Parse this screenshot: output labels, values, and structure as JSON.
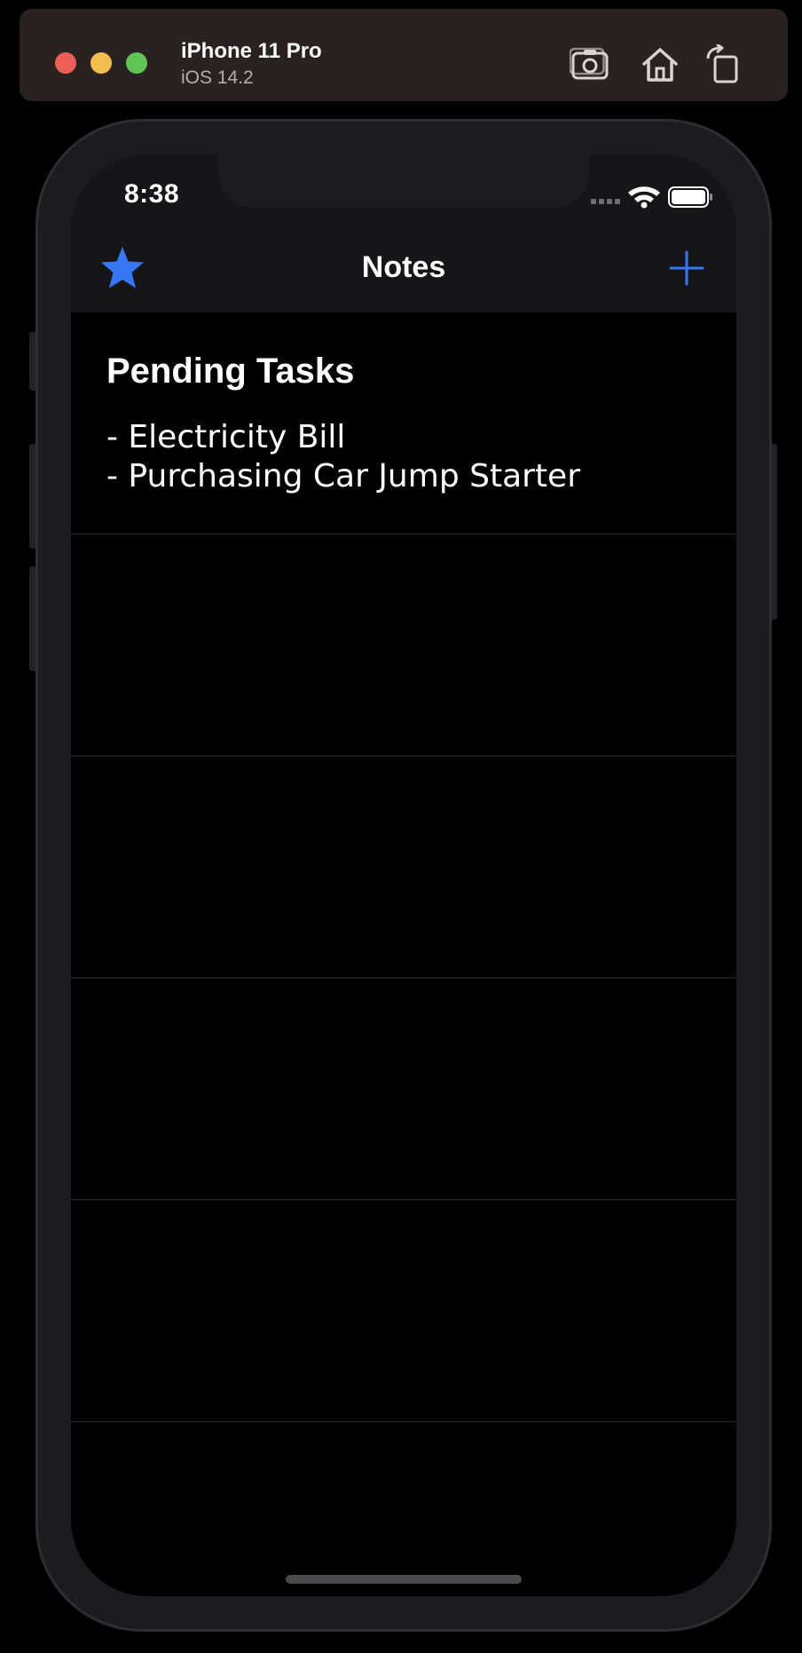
{
  "simulator": {
    "device_name": "iPhone 11 Pro",
    "os_version": "iOS 14.2",
    "toolbar_icons": [
      "camera-icon",
      "home-icon",
      "rotate-icon"
    ]
  },
  "status_bar": {
    "time": "8:38",
    "icons": [
      "signal-icon",
      "wifi-icon",
      "battery-icon"
    ]
  },
  "nav_bar": {
    "title": "Notes",
    "left_icon": "star-icon",
    "right_icon": "plus-icon",
    "accent_color": "#3478f6"
  },
  "notes": [
    {
      "title": "Pending Tasks",
      "lines": [
        "- Electricity Bill",
        "- Purchasing Car Jump Starter"
      ]
    },
    {
      "title": "",
      "lines": []
    },
    {
      "title": "",
      "lines": []
    },
    {
      "title": "",
      "lines": []
    },
    {
      "title": "",
      "lines": []
    }
  ],
  "colors": {
    "background": "#000000",
    "nav_background": "#161618",
    "separator": "#2c2c2e",
    "text": "#ffffff"
  }
}
